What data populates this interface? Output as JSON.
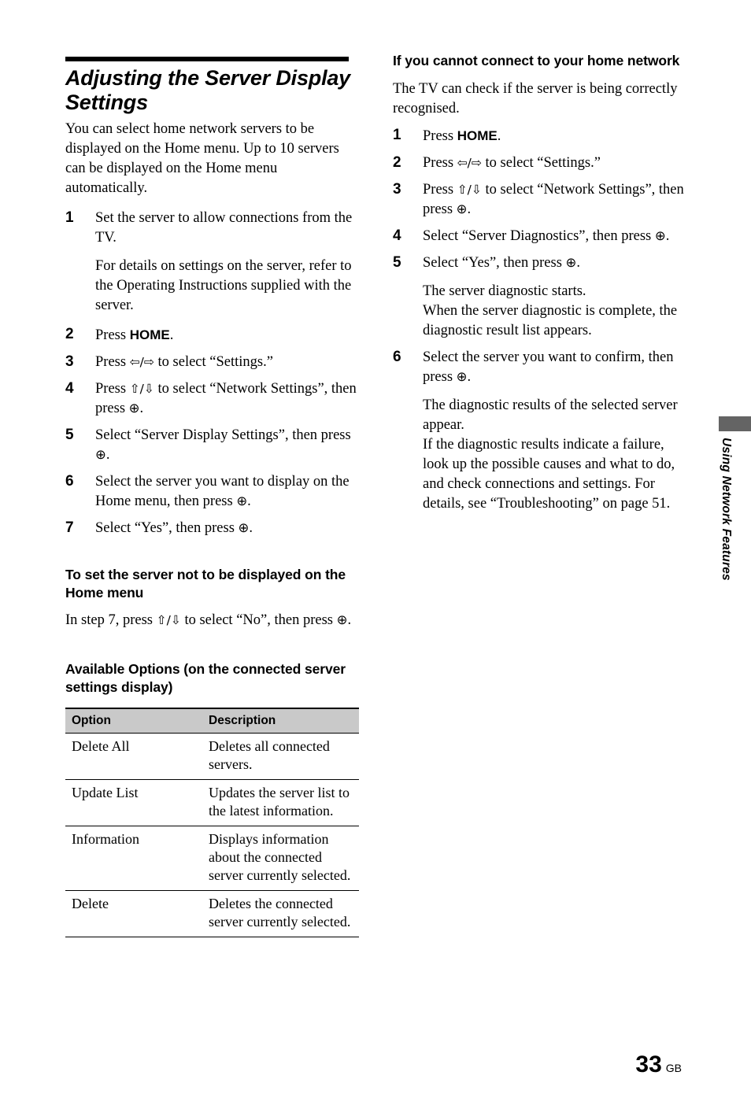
{
  "document": {
    "page_number": "33",
    "page_region_code": "GB",
    "side_tab_label": "Using Network Features"
  },
  "glyphs": {
    "left_right": "⇦/⇨",
    "up_down": "⇧/⇩",
    "enter": "⊕"
  },
  "left_column": {
    "section_title": "Adjusting the Server Display Settings",
    "intro": "You can select home network servers to be displayed on the Home menu. Up to 10 servers can be displayed on the Home menu automatically.",
    "steps": [
      {
        "num": "1",
        "text": "Set the server to allow connections from the TV.",
        "sub": "For details on settings on the server, refer to the Operating Instructions supplied with the server."
      },
      {
        "num": "2",
        "pre": "Press ",
        "kbd": "HOME",
        "post": "."
      },
      {
        "num": "3",
        "pre": "Press ",
        "glyph": "left_right",
        "post": " to select “Settings.”"
      },
      {
        "num": "4",
        "pre": "Press ",
        "glyph": "up_down",
        "post": " to select “Network Settings”, then press ",
        "glyph2": "enter",
        "post2": "."
      },
      {
        "num": "5",
        "pre": "Select “Server Display Settings”, then press ",
        "glyph2": "enter",
        "post2": "."
      },
      {
        "num": "6",
        "pre": "Select the server you want to display on the Home menu, then press ",
        "glyph2": "enter",
        "post2": "."
      },
      {
        "num": "7",
        "pre": "Select “Yes”, then press ",
        "glyph2": "enter",
        "post2": "."
      }
    ],
    "subhead_not_displayed": "To set the server not to be displayed on the Home menu",
    "not_displayed_pre": "In step 7, press ",
    "not_displayed_mid": " to select “No”, then press ",
    "not_displayed_post": ".",
    "subhead_options": "Available Options (on the connected server settings display)",
    "table": {
      "headers": [
        "Option",
        "Description"
      ],
      "rows": [
        [
          "Delete All",
          "Deletes all connected servers."
        ],
        [
          "Update List",
          "Updates the server list to the latest information."
        ],
        [
          "Information",
          "Displays information about the connected server currently selected."
        ],
        [
          "Delete",
          "Deletes the connected server currently selected."
        ]
      ]
    }
  },
  "right_column": {
    "subhead": "If you cannot connect to your home network",
    "intro": "The TV can check if the server is being correctly recognised.",
    "steps": [
      {
        "num": "1",
        "pre": "Press ",
        "kbd": "HOME",
        "post": "."
      },
      {
        "num": "2",
        "pre": "Press ",
        "glyph": "left_right",
        "post": " to select “Settings.”"
      },
      {
        "num": "3",
        "pre": "Press ",
        "glyph": "up_down",
        "post": " to select “Network Settings”, then press ",
        "glyph2": "enter",
        "post2": "."
      },
      {
        "num": "4",
        "pre": "Select “Server Diagnostics”, then press ",
        "glyph2": "enter",
        "post2": "."
      },
      {
        "num": "5",
        "pre": "Select “Yes”, then press ",
        "glyph2": "enter",
        "post2": ".",
        "sub": "The server diagnostic starts.\nWhen the server diagnostic is complete, the diagnostic result list appears."
      },
      {
        "num": "6",
        "pre": "Select the server you want to confirm, then press ",
        "glyph2": "enter",
        "post2": ".",
        "sub": "The diagnostic results of the selected server appear.\nIf the diagnostic results indicate a failure, look up the possible causes and what to do, and check connections and settings. For details, see “Troubleshooting” on page 51."
      }
    ]
  }
}
